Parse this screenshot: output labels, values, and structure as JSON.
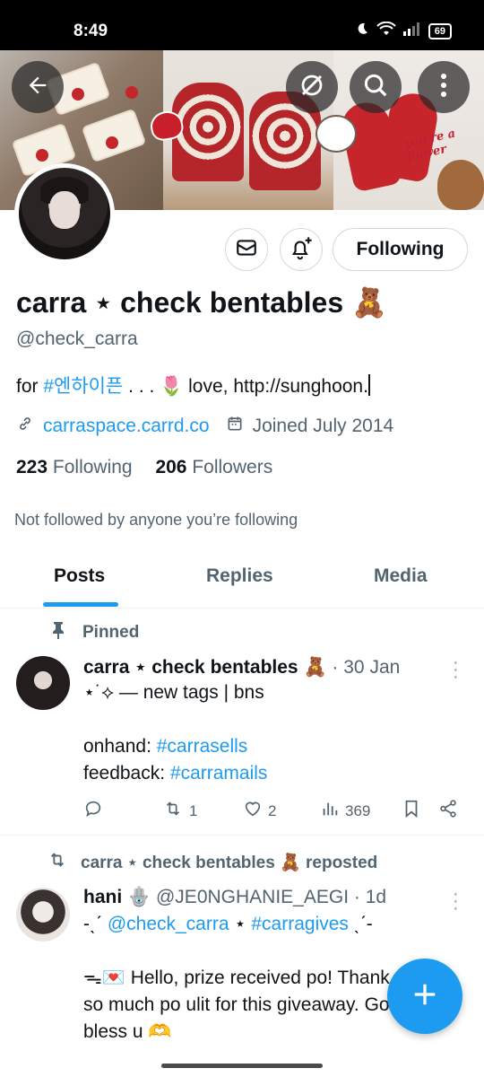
{
  "status": {
    "time": "8:49",
    "battery": "69"
  },
  "banner": {
    "overlay_text": "you're a flower"
  },
  "profile": {
    "display_name": "carra ⋆ check bentables 🧸",
    "handle": "@check_carra",
    "bio_prefix": "for ",
    "bio_hashtag": "#엔하이픈",
    "bio_suffix": " . . . 🌷 love, http://sunghoon.",
    "website": "carraspace.carrd.co",
    "joined": "Joined July 2014",
    "following_count": "223",
    "following_label": "Following",
    "followers_count": "206",
    "followers_label": "Followers",
    "not_followed": "Not followed by anyone you’re following",
    "follow_button": "Following"
  },
  "tabs": [
    {
      "label": "Posts",
      "active": true
    },
    {
      "label": "Replies",
      "active": false
    },
    {
      "label": "Media",
      "active": false
    }
  ],
  "posts": [
    {
      "pinned_label": "Pinned",
      "author": "carra ⋆ check bentables 🧸",
      "time": " · 30 Jan",
      "lines": [
        "⋆˙✧ — new tags | bns",
        "",
        "onhand: ",
        "feedback: "
      ],
      "line1": "⋆˙⟡ — new tags | bns",
      "line3_prefix": "onhand: ",
      "line3_tag": "#carrasells",
      "line4_prefix": "feedback: ",
      "line4_tag": "#carramails",
      "replies": "",
      "reposts": "1",
      "likes": "2",
      "views": "369"
    },
    {
      "repost_label": "carra ⋆ check bentables 🧸 reposted",
      "author": "hani 🪬",
      "author_handle": " @JE0NGHANIE_AEGI · 1d",
      "line1_prefix": "-ˎˊ ",
      "line1_mention": "@check_carra",
      "line1_mid": " ⋆ ",
      "line1_tag": "#carragives",
      "line1_suffix": " ˎˊ-",
      "line2": "ᯓ💌 Hello, prize received po! Thank you",
      "line3": "so much po ulit for this giveaway. God",
      "line4": "bless u 🫶"
    }
  ],
  "colors": {
    "accent": "#1d9bf0",
    "muted": "#536471",
    "text": "#0f1419"
  }
}
